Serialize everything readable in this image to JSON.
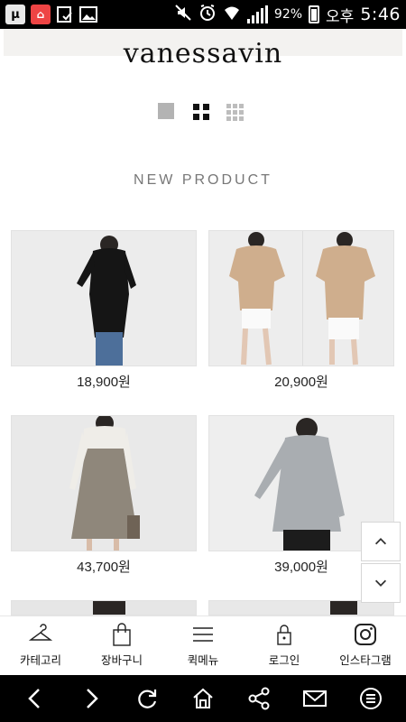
{
  "status_bar": {
    "battery": "92%",
    "ampm": "오후",
    "time": "5:46",
    "icons": [
      "utorrent-icon",
      "home-launcher-icon",
      "download-done-icon",
      "gallery-icon",
      "mute-icon",
      "alarm-icon",
      "wifi-icon",
      "signal-icon",
      "battery-icon"
    ]
  },
  "header": {
    "brand": "vanessavin"
  },
  "view_toggles": [
    "view-1col-icon",
    "view-2col-icon",
    "view-3col-icon"
  ],
  "section": {
    "title": "NEW PRODUCT"
  },
  "products": [
    {
      "price": "18,900원",
      "colors": {
        "top": "#151515",
        "bottom": "#4d6f9a",
        "bg": "#ececec"
      }
    },
    {
      "price": "20,900원",
      "colors": {
        "top": "#cfae8d",
        "bottom": "#fafafa",
        "bg": "#ededed"
      }
    },
    {
      "price": "43,700원",
      "colors": {
        "top": "#8f877b",
        "bottom": "#8f877b",
        "bg": "#e9e9e9"
      }
    },
    {
      "price": "39,000원",
      "colors": {
        "top": "#a9adb1",
        "bottom": "#1c1c1c",
        "bg": "#eeeeee"
      }
    }
  ],
  "scroll_buttons": {
    "up": "chevron-up-icon",
    "down": "chevron-down-icon"
  },
  "bottom_nav": [
    {
      "label": "카테고리",
      "icon": "hanger-icon"
    },
    {
      "label": "장바구니",
      "icon": "shopping-bag-icon"
    },
    {
      "label": "퀵메뉴",
      "icon": "menu-icon"
    },
    {
      "label": "로그인",
      "icon": "lock-icon"
    },
    {
      "label": "인스타그램",
      "icon": "instagram-icon"
    }
  ],
  "browser_bar": [
    "back-icon",
    "forward-icon",
    "refresh-icon",
    "home-icon",
    "share-icon",
    "mail-icon",
    "menu-circle-icon"
  ]
}
